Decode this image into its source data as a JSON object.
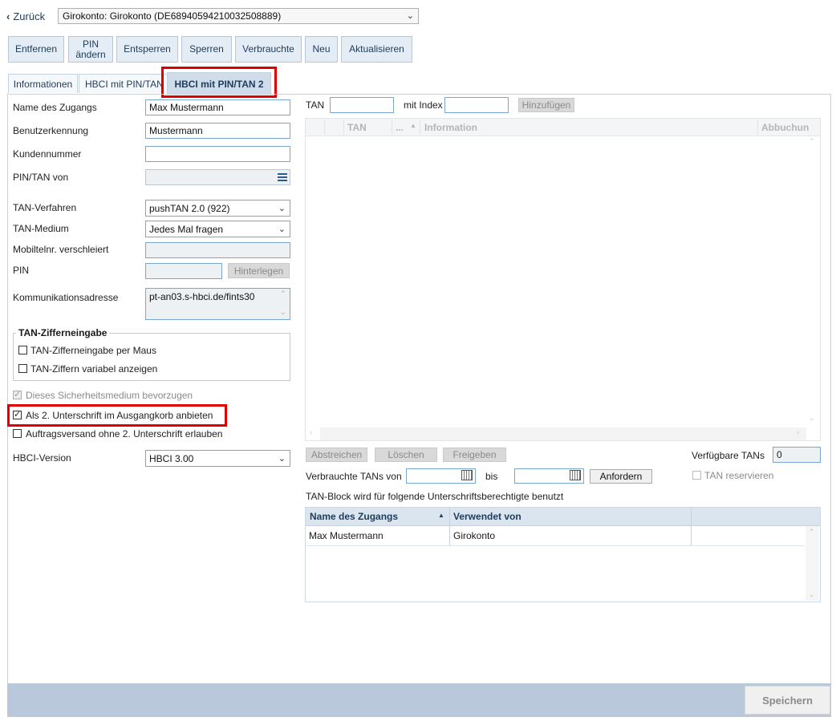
{
  "nav": {
    "back_label": "Zurück",
    "account_select": "Girokonto: Girokonto (DE68940594210032508889)"
  },
  "toolbar": {
    "remove": "Entfernen",
    "pin_change_line1": "PIN",
    "pin_change_line2": "ändern",
    "unlock": "Entsperren",
    "lock": "Sperren",
    "used": "Verbrauchte",
    "new": "Neu",
    "refresh": "Aktualisieren"
  },
  "tabs": [
    {
      "label": "Informationen"
    },
    {
      "label": "HBCI mit PIN/TAN"
    },
    {
      "label": "HBCI mit PIN/TAN 2"
    }
  ],
  "form": {
    "access_name_label": "Name des Zugangs",
    "access_name_value": "Max Mustermann",
    "user_id_label": "Benutzerkennung",
    "user_id_value": "Mustermann",
    "customer_no_label": "Kundennummer",
    "customer_no_value": "",
    "pintan_from_label": "PIN/TAN von",
    "tan_method_label": "TAN-Verfahren",
    "tan_method_value": "pushTAN 2.0 (922)",
    "tan_medium_label": "TAN-Medium",
    "tan_medium_value": "Jedes Mal fragen",
    "mobile_label": "Mobiltelnr. verschleiert",
    "pin_label": "PIN",
    "deposit_button": "Hinterlegen",
    "comm_address_label": "Kommunikationsadresse",
    "comm_address_value": "pt-an03.s-hbci.de/fints30",
    "group_title": "TAN-Zifferneingabe",
    "cb_mouse": "TAN-Zifferneingabe per Maus",
    "cb_variable": "TAN-Ziffern variabel anzeigen",
    "cb_prefer": "Dieses Sicherheitsmedium bevorzugen",
    "cb_second_sig": "Als 2. Unterschrift im Ausgangkorb anbieten",
    "cb_no_second": "Auftragsversand ohne 2. Unterschrift erlauben",
    "hbci_version_label": "HBCI-Version",
    "hbci_version_value": "HBCI 3.00"
  },
  "tan_panel": {
    "tan_label": "TAN",
    "index_label": "mit Index",
    "add_button": "Hinzufügen",
    "col_tan": "TAN",
    "col_dots": "...",
    "col_info": "Information",
    "col_booking": "Abbuchun",
    "strike_button": "Abstreichen",
    "delete_button": "Löschen",
    "release_button": "Freigeben",
    "available_label": "Verfügbare TANs",
    "available_value": "0",
    "used_from_label": "Verbrauchte TANs von",
    "to_label": "bis",
    "request_button": "Anfordern",
    "reserve_label": "TAN reservieren",
    "block_caption": "TAN-Block wird für folgende Unterschriftsberechtigte benutzt"
  },
  "users_table": {
    "headers": [
      "Name des Zugangs",
      "Verwendet von"
    ],
    "rows": [
      {
        "name": "Max Mustermann",
        "used_by": "Girokonto"
      }
    ]
  },
  "footer": {
    "save": "Speichern"
  },
  "icons": [
    "chevron-left-icon",
    "chevron-down-icon",
    "list-icon",
    "calendar-icon",
    "sort-up-icon"
  ],
  "colors": {
    "highlight": "#e00000",
    "footer_bar": "#b9c9db",
    "header_text": "#1f3b5a"
  }
}
